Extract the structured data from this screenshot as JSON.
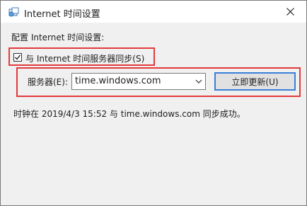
{
  "window": {
    "title": "Internet 时间设置",
    "close_label": "Close"
  },
  "config": {
    "section_label": "配置 Internet 时间设置:",
    "sync_checkbox": {
      "label": "与 Internet 时间服务器同步(S)",
      "checked": true
    },
    "server": {
      "label": "服务器(E):",
      "value": "time.windows.com"
    },
    "update_button": "立即更新(U)",
    "status": "时钟在 2019/4/3 15:52 与 time.windows.com 同步成功。"
  },
  "colors": {
    "highlight_border": "#e43a3a",
    "button_focus": "#3a7fd9"
  }
}
